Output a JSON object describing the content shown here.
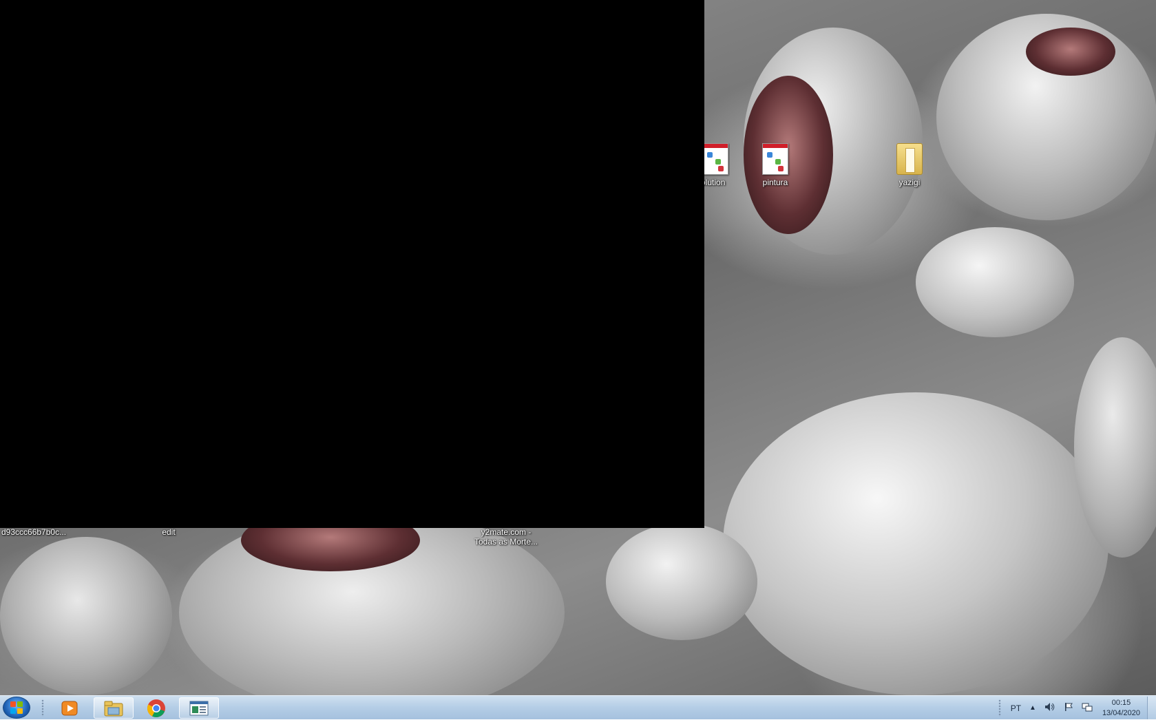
{
  "desktop": {
    "icons": [
      {
        "label": "olution",
        "type": "document-icon"
      },
      {
        "label": "pintura",
        "type": "document-icon"
      },
      {
        "label": "yazigi",
        "type": "folder-icon"
      }
    ],
    "bottom_labels": {
      "first": "d93ccc66b7b0c...",
      "second": "edit",
      "third_line1": "y2mate.com -",
      "third_line2": "Todas as Morte..."
    }
  },
  "taskbar": {
    "pinned": [
      "media-player-icon",
      "file-explorer-icon",
      "chrome-icon",
      "app-window-icon"
    ],
    "tray": {
      "language": "PT",
      "time": "00:15",
      "date": "13/04/2020"
    }
  },
  "colors": {
    "taskbar": "#b4cde6",
    "black_window": "#000000"
  }
}
